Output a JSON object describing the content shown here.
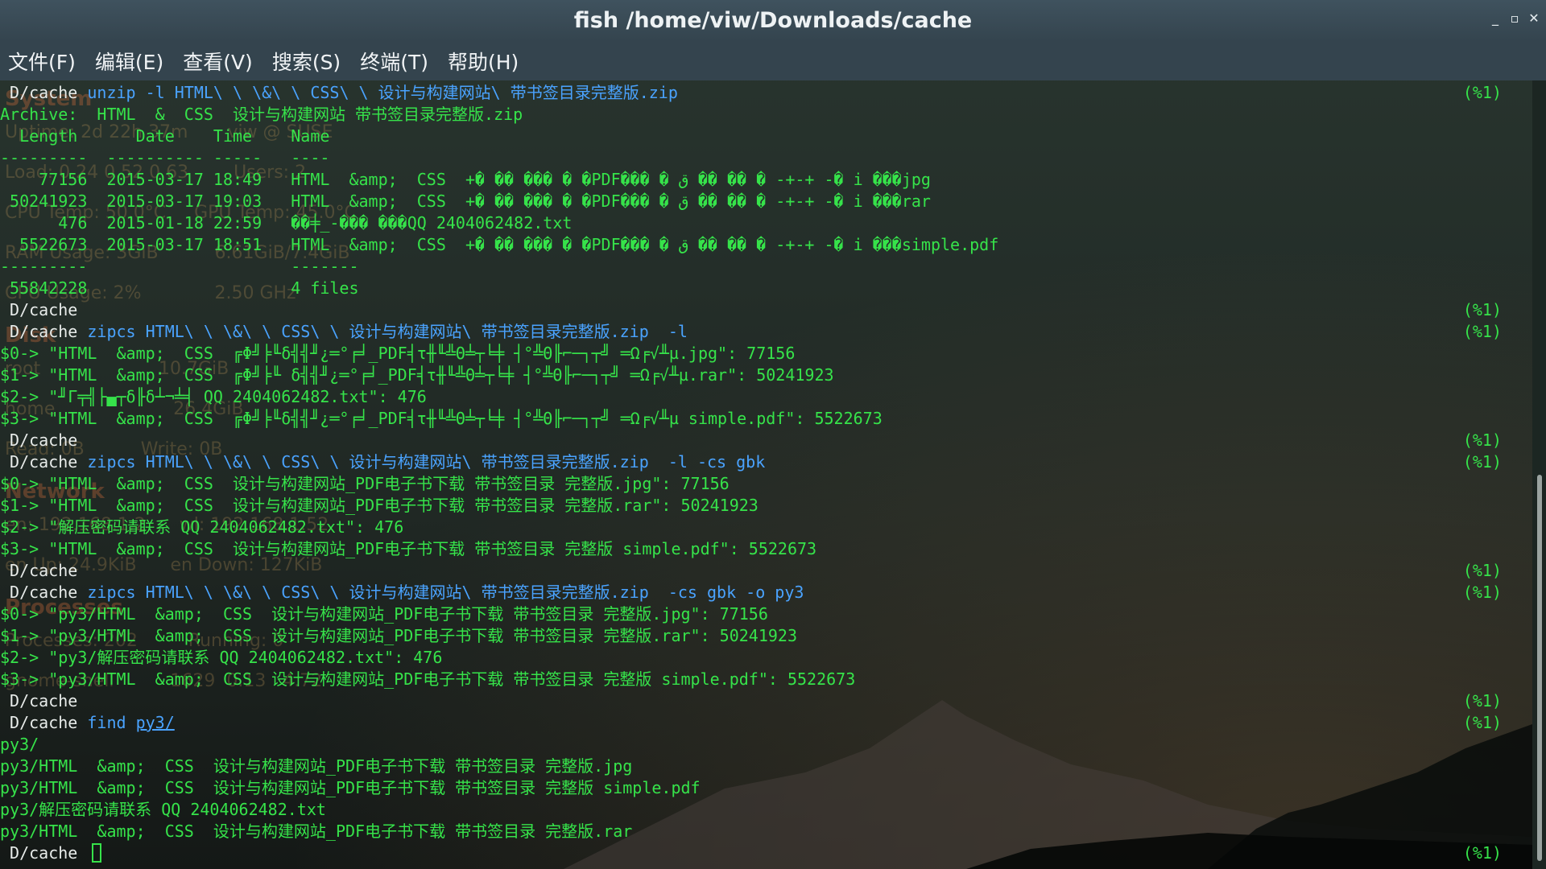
{
  "window": {
    "title": "fish  /home/viw/Downloads/cache",
    "controls": {
      "minimize": "_",
      "maximize": "▫",
      "close": "✕"
    }
  },
  "menu": [
    "文件(F)",
    "编辑(E)",
    "查看(V)",
    "搜索(S)",
    "终端(T)",
    "帮助(H)"
  ],
  "prompt_dir": "D/cache",
  "status_mark": "(%1)",
  "lines": [
    {
      "prompt": "D/cache ",
      "cmd": "unzip",
      "args": " -l HTML\\ \\ \\&\\ \\ CSS\\ \\ 设计与构建网站\\ 带书签目录完整版.zip",
      "status": "(%1)"
    },
    {
      "out": "Archive:  HTML  &  CSS  设计与构建网站 带书签目录完整版.zip"
    },
    {
      "out": "  Length      Date    Time    Name"
    },
    {
      "out": "---------  ---------- -----   ----"
    },
    {
      "out": "    77156  2015-03-17 18:49   HTML  &amp;  CSS  +� �� ��� � �PDF��� � ق �� �� � -+-+ -� i ���jpg"
    },
    {
      "out": " 50241923  2015-03-17 19:03   HTML  &amp;  CSS  +� �� ��� � �PDF��� � ق �� �� � -+-+ -� i ���rar"
    },
    {
      "out": "      476  2015-01-18 22:59   ��╪_-��� ���QQ 2404062482.txt"
    },
    {
      "out": "  5522673  2015-03-17 18:51   HTML  &amp;  CSS  +� �� ��� � �PDF��� � ق �� �� � -+-+ -� i ���simple.pdf"
    },
    {
      "out": "---------                     -------"
    },
    {
      "out": " 55842228                     4 files"
    },
    {
      "prompt": "D/cache ",
      "cmd": "",
      "args": "",
      "status": "(%1)"
    },
    {
      "prompt": "D/cache ",
      "cmd": "zipcs",
      "args": " HTML\\ \\ \\&\\ \\ CSS\\ \\ 设计与构建网站\\ 带书签目录完整版.zip  -l",
      "status": "(%1)"
    },
    {
      "out": "$0-> \"HTML  &amp;  CSS  ╔Φ╝╞╙δ╣╣╜¿═°╒╛_PDF╡τ╫╙╩Θ╧┬╘╪ ┤°╩Θ╟⌐─┐┬╝ ═Ω╒√╨µ.jpg\": 77156"
    },
    {
      "out": "$1-> \"HTML  &amp;  CSS  ╔Φ╝╞╙ δ╣╣╜¿═°╒╛_PDF╡τ╫╙╩Θ╧┬╘╪ ┤°╩Θ╟⌐─┐┬╝ ═Ω╒√╨µ.rar\": 50241923"
    },
    {
      "out": "$2-> \"╜Γ╤╣├▄┬δ╟δ┴¬╧╡ QQ 2404062482.txt\": 476"
    },
    {
      "out": "$3-> \"HTML  &amp;  CSS  ╔Φ╝╞╙δ╣╣╜¿═°╒╛_PDF╡τ╫╙╩Θ╧┬╘╪ ┤°╩Θ╟⌐─┐┬╝ ═Ω╒√╨µ simple.pdf\": 5522673"
    },
    {
      "prompt": "D/cache ",
      "cmd": "",
      "args": "",
      "status": "(%1)"
    },
    {
      "prompt": "D/cache ",
      "cmd": "zipcs",
      "args": " HTML\\ \\ \\&\\ \\ CSS\\ \\ 设计与构建网站\\ 带书签目录完整版.zip  -l -cs gbk",
      "status": "(%1)"
    },
    {
      "out": "$0-> \"HTML  &amp;  CSS  设计与构建网站_PDF电子书下载 带书签目录 完整版.jpg\": 77156"
    },
    {
      "out": "$1-> \"HTML  &amp;  CSS  设计与构建网站_PDF电子书下载 带书签目录 完整版.rar\": 50241923"
    },
    {
      "out": "$2-> \"解压密码请联系 QQ 2404062482.txt\": 476"
    },
    {
      "out": "$3-> \"HTML  &amp;  CSS  设计与构建网站_PDF电子书下载 带书签目录 完整版 simple.pdf\": 5522673"
    },
    {
      "prompt": "D/cache ",
      "cmd": "",
      "args": "",
      "status": "(%1)"
    },
    {
      "prompt": "D/cache ",
      "cmd": "zipcs",
      "args": " HTML\\ \\ \\&\\ \\ CSS\\ \\ 设计与构建网站\\ 带书签目录完整版.zip  -cs gbk -o py3",
      "status": "(%1)"
    },
    {
      "out": "$0-> \"py3/HTML  &amp;  CSS  设计与构建网站_PDF电子书下载 带书签目录 完整版.jpg\": 77156"
    },
    {
      "out": "$1-> \"py3/HTML  &amp;  CSS  设计与构建网站_PDF电子书下载 带书签目录 完整版.rar\": 50241923"
    },
    {
      "out": "$2-> \"py3/解压密码请联系 QQ 2404062482.txt\": 476"
    },
    {
      "out": "$3-> \"py3/HTML  &amp;  CSS  设计与构建网站_PDF电子书下载 带书签目录 完整版 simple.pdf\": 5522673"
    },
    {
      "prompt": "D/cache ",
      "cmd": "",
      "args": "",
      "status": "(%1)"
    },
    {
      "prompt": "D/cache ",
      "cmd": "find",
      "args": " ",
      "path": "py3/",
      "status": "(%1)"
    },
    {
      "out": "py3/"
    },
    {
      "out": "py3/HTML  &amp;  CSS  设计与构建网站_PDF电子书下载 带书签目录 完整版.jpg"
    },
    {
      "out": "py3/HTML  &amp;  CSS  设计与构建网站_PDF电子书下载 带书签目录 完整版 simple.pdf"
    },
    {
      "out": "py3/解压密码请联系 QQ 2404062482.txt"
    },
    {
      "out": "py3/HTML  &amp;  CSS  设计与构建网站_PDF电子书下载 带书签目录 完整版.rar"
    },
    {
      "prompt": "D/cache ",
      "cmd": "",
      "args": "",
      "status": "(%1)",
      "cursor": true
    }
  ],
  "conky": [
    {
      "text": "System",
      "head": true
    },
    {
      "text": "Uptime: 2d 22h 37m       viw @ SUSE"
    },
    {
      "text": "Load: 0.24 0.52 0.63        Users: 2"
    },
    {
      "text": "CPU Temp: 50.0°C     GPU Temp: 45.0°C"
    },
    {
      "text": "RAM Usage: 3GiB          6.61GiB/7.4GiB"
    },
    {
      "text": "CPU Usage: 2%             2.50 GHz"
    },
    {
      "text": "Disk",
      "head": true
    },
    {
      "text": "root                     10.7GiB"
    },
    {
      "text": "home                     26.4GiB"
    },
    {
      "text": "Read: 0B          Write: 0B"
    },
    {
      "text": "Network",
      "head": true
    },
    {
      "text": "en: 192.168.1.2      wl: 192.168.1.52"
    },
    {
      "text": "en Up: 24.9KiB      en Down: 127KiB"
    },
    {
      "text": "Processes",
      "head": true
    },
    {
      "text": "Processes: 202         Running: 0"
    },
    {
      "text": "gnome-shell          1629  0.13   4.72"
    }
  ],
  "colors": {
    "prompt": "#e8ecea",
    "command": "#4aa3ff",
    "output": "#36e34a",
    "titlebar": "#3a4b56"
  }
}
